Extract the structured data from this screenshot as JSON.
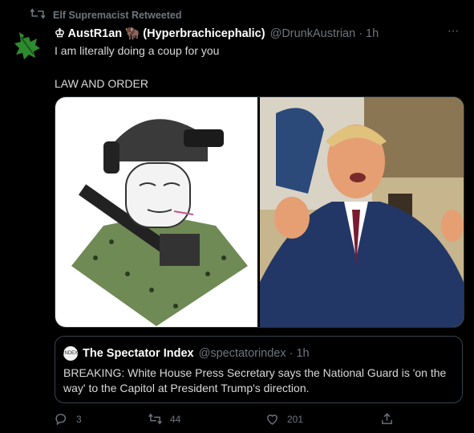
{
  "retweet": {
    "label": "Elf Supremacist Retweeted"
  },
  "tweet": {
    "display_name": "♔ AustR1an 🦬 (Hyperbrachicephalic)",
    "handle": "@DrunkAustrian",
    "separator": "·",
    "time": "1h",
    "more_label": "⋯",
    "text_line1": "I am literally doing a coup for you",
    "text_line2": "LAW AND ORDER"
  },
  "quote": {
    "avatar_text": "INDEX",
    "display_name": "The Spectator Index",
    "handle": "@spectatorindex",
    "separator": "·",
    "time": "1h",
    "text": "BREAKING: White House Press Secretary says the National Guard is 'on the way' to the Capitol at President Trump's direction."
  },
  "actions": {
    "reply_count": "3",
    "retweet_count": "44",
    "like_count": "201"
  },
  "icons": {
    "retweet": "retweet-icon",
    "avatar": "leaf-avatar-icon",
    "reply": "reply-icon",
    "like": "heart-icon",
    "share": "share-icon",
    "more": "more-icon"
  },
  "colors": {
    "background": "#000000",
    "muted": "#6e767d",
    "text": "#d9d9d9",
    "border": "#38444d"
  }
}
